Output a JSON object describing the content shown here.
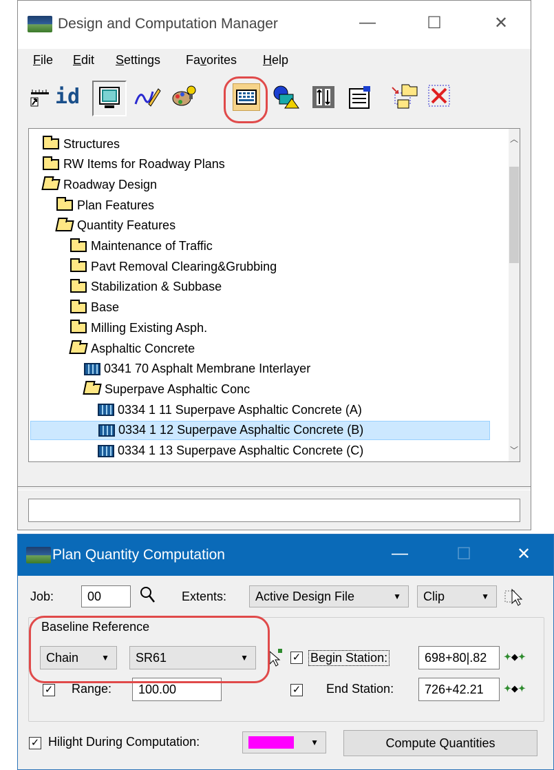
{
  "dcm": {
    "title": "Design and Computation Manager",
    "window_controls": {
      "minimize": "—",
      "maximize": "☐",
      "close": "✕"
    },
    "menus": [
      {
        "label": "File",
        "accel": "F",
        "rest": "ile"
      },
      {
        "label": "Edit",
        "accel": "E",
        "rest": "dit"
      },
      {
        "label": "Settings",
        "accel": "S",
        "rest": "ettings"
      },
      {
        "label": "Favorites",
        "pre": "Fa",
        "accel": "v",
        "rest": "orites"
      },
      {
        "label": "Help",
        "accel": "H",
        "rest": "elp"
      }
    ],
    "toolbar": {
      "id_label": "id",
      "icons": [
        "ruler-icon",
        "id-icon",
        "monitor-icon",
        "pencil-curve-icon",
        "palette-icon",
        "computation-icon",
        "shapes-icon",
        "data-icon",
        "settings-list-icon",
        "new-folder-icon",
        "delete-icon"
      ]
    },
    "tree": [
      {
        "label": "Structures",
        "type": "folder",
        "open": false,
        "level": 0
      },
      {
        "label": "RW Items for Roadway Plans",
        "type": "folder",
        "open": false,
        "level": 0
      },
      {
        "label": "Roadway Design",
        "type": "folder",
        "open": true,
        "level": 0
      },
      {
        "label": "Plan Features",
        "type": "folder",
        "open": false,
        "level": 1
      },
      {
        "label": "Quantity Features",
        "type": "folder",
        "open": true,
        "level": 1
      },
      {
        "label": "Maintenance of Traffic",
        "type": "folder",
        "open": false,
        "level": 2
      },
      {
        "label": "Pavt Removal Clearing&Grubbing",
        "type": "folder",
        "open": false,
        "level": 2
      },
      {
        "label": "Stabilization & Subbase",
        "type": "folder",
        "open": false,
        "level": 2
      },
      {
        "label": "Base",
        "type": "folder",
        "open": false,
        "level": 2
      },
      {
        "label": "Milling Existing Asph.",
        "type": "folder",
        "open": false,
        "level": 2
      },
      {
        "label": "Asphaltic Concrete",
        "type": "folder",
        "open": true,
        "level": 2
      },
      {
        "label": "0341 70 Asphalt Membrane Interlayer",
        "type": "item",
        "level": 3
      },
      {
        "label": "Superpave Asphaltic Conc",
        "type": "folder",
        "open": true,
        "level": 3
      },
      {
        "label": "0334  1 11 Superpave Asphaltic Concrete (A)",
        "type": "item",
        "level": 4
      },
      {
        "label": "0334  1 12 Superpave Asphaltic Concrete (B)",
        "type": "item",
        "level": 4,
        "selected": true
      },
      {
        "label": "0334  1 13 Superpave Asphaltic Concrete (C)",
        "type": "item",
        "level": 4
      }
    ],
    "status_text": ""
  },
  "pqc": {
    "title": "Plan Quantity Computation",
    "window_controls": {
      "minimize": "—",
      "maximize": "☐",
      "close": "✕"
    },
    "job_label": "Job:",
    "job_value": "00",
    "extents_label": "Extents:",
    "extents_value": "Active Design File",
    "clip_value": "Clip",
    "baseline_label": "Baseline Reference",
    "chain_value": "Chain",
    "sr_value": "SR61",
    "begin_station_label": "Begin Station:",
    "begin_station_value": "698+80|.82",
    "begin_station_checked": true,
    "range_label": "Range:",
    "range_value": "100.00",
    "range_checked": true,
    "end_station_label": "End Station:",
    "end_station_value": "726+42.21",
    "end_station_checked": true,
    "hilight_label": "Hilight During Computation:",
    "hilight_checked": true,
    "hilight_color": "#ff00ff",
    "compute_label": "Compute Quantities",
    "check_glyph": "✓"
  },
  "annotation_color": "#e04a4a"
}
